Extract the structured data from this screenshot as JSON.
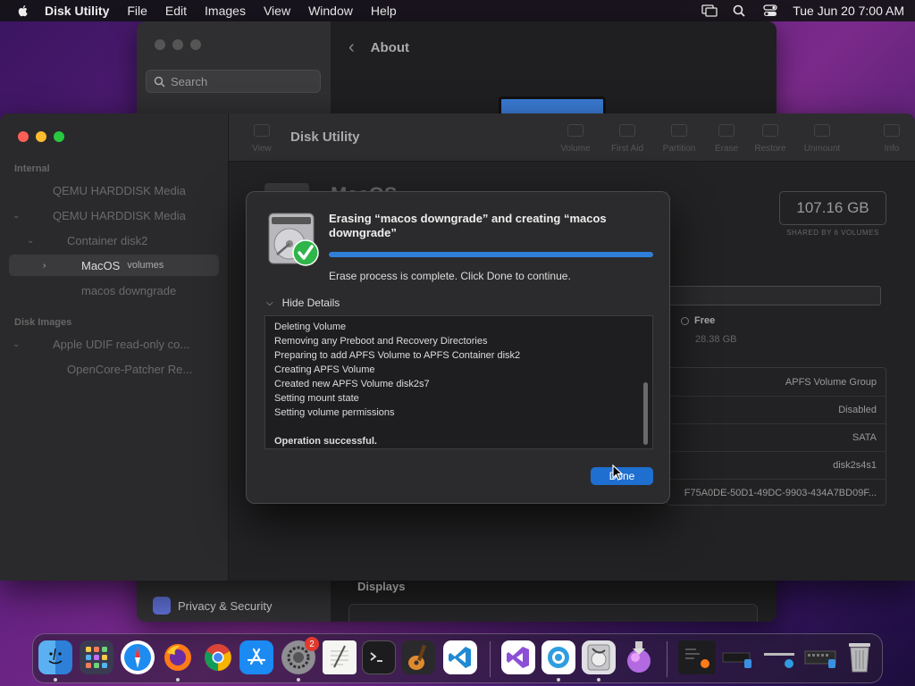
{
  "menubar": {
    "app_name": "Disk Utility",
    "items": [
      "File",
      "Edit",
      "Images",
      "View",
      "Window",
      "Help"
    ],
    "clock": "Tue Jun 20  7:00 AM"
  },
  "settings_window": {
    "search_placeholder": "Search",
    "header": "About",
    "sidebar_item": "Privacy & Security",
    "displays_label": "Displays"
  },
  "disk_utility": {
    "title": "Disk Utility",
    "toolbar": [
      "View",
      "Volume",
      "First Aid",
      "Partition",
      "Erase",
      "Restore",
      "Unmount",
      "Info"
    ],
    "sidebar": {
      "internal_label": "Internal",
      "disk_images_label": "Disk Images",
      "items": [
        {
          "label": "QEMU HARDDISK Media"
        },
        {
          "label": "QEMU HARDDISK Media"
        },
        {
          "label": "Container disk2"
        },
        {
          "label": "MacOS",
          "sub": "volumes"
        },
        {
          "label": "macos downgrade"
        },
        {
          "label": "Apple UDIF read-only co..."
        },
        {
          "label": "OpenCore-Patcher Re..."
        }
      ]
    },
    "volume_name": "MacOS",
    "capacity": "107.16 GB",
    "capacity_sub": "SHARED BY 6 VOLUMES",
    "free_label": "Free",
    "free_value": "28.38 GB",
    "info_values": [
      "APFS Volume Group",
      "Disabled",
      "SATA",
      "disk2s4s1",
      "F75A0DE-50D1-49DC-9903-434A7BD09F..."
    ]
  },
  "dialog": {
    "title": "Erasing “macos downgrade” and creating “macos downgrade”",
    "progress": 1.0,
    "status": "Erase process is complete. Click Done to continue.",
    "details_toggle": "Hide Details",
    "log": [
      "Deleting Volume",
      "Removing any Preboot and Recovery Directories",
      "Preparing to add APFS Volume to APFS Container disk2",
      "Creating APFS Volume",
      "Created new APFS Volume disk2s7",
      "Setting mount state",
      "Setting volume permissions",
      "",
      "Operation successful."
    ],
    "done_label": "Done"
  },
  "dock": {
    "settings_badge": "2",
    "apps": [
      "finder-icon",
      "launchpad-icon",
      "safari-icon",
      "firefox-icon",
      "chrome-icon",
      "app-store-icon",
      "system-settings-icon",
      "textedit-icon",
      "terminal-icon",
      "garageband-icon",
      "vscode-icon",
      "visual-studio-icon",
      "opencore-icon",
      "disk-utility-icon",
      "installer-icon",
      "trash-icon"
    ]
  }
}
